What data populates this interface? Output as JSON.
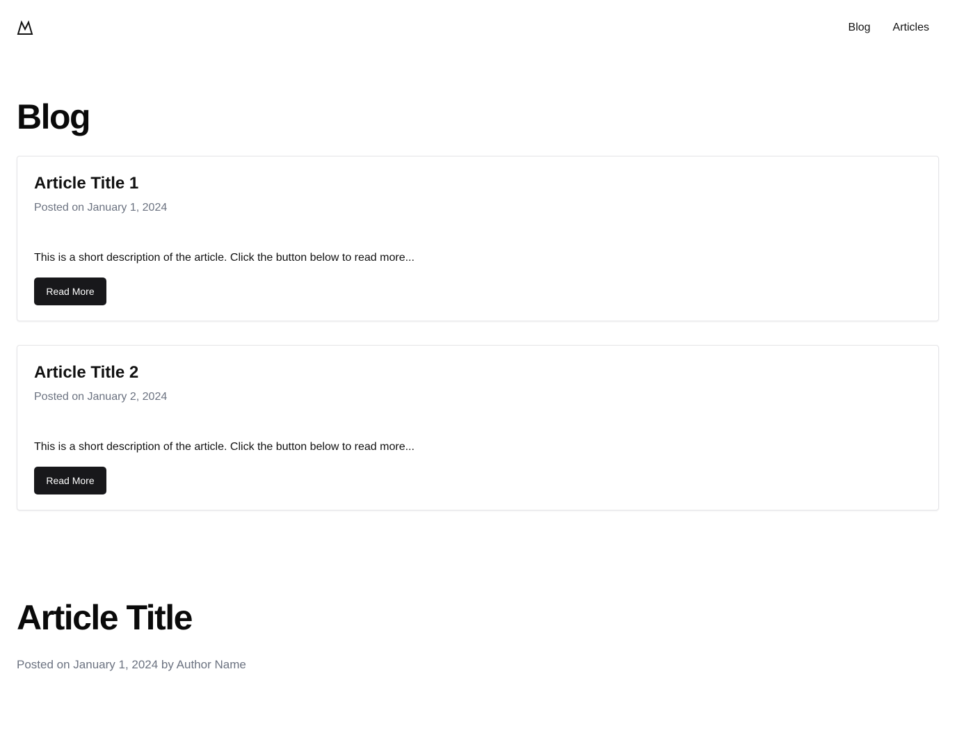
{
  "header": {
    "logo_icon": "mountain-logo-icon",
    "nav": [
      {
        "label": "Blog"
      },
      {
        "label": "Articles"
      }
    ]
  },
  "blog": {
    "title": "Blog",
    "posts": [
      {
        "title": "Article Title 1",
        "date": "Posted on January 1, 2024",
        "description": "This is a short description of the article. Click the button below to read more...",
        "button_label": "Read More"
      },
      {
        "title": "Article Title 2",
        "date": "Posted on January 2, 2024",
        "description": "This is a short description of the article. Click the button below to read more...",
        "button_label": "Read More"
      }
    ]
  },
  "article": {
    "title": "Article Title",
    "meta": "Posted on January 1, 2024 by Author Name"
  },
  "colors": {
    "button_bg": "#18181b",
    "muted_text": "#6b7280",
    "card_border": "#e4e4e7"
  }
}
